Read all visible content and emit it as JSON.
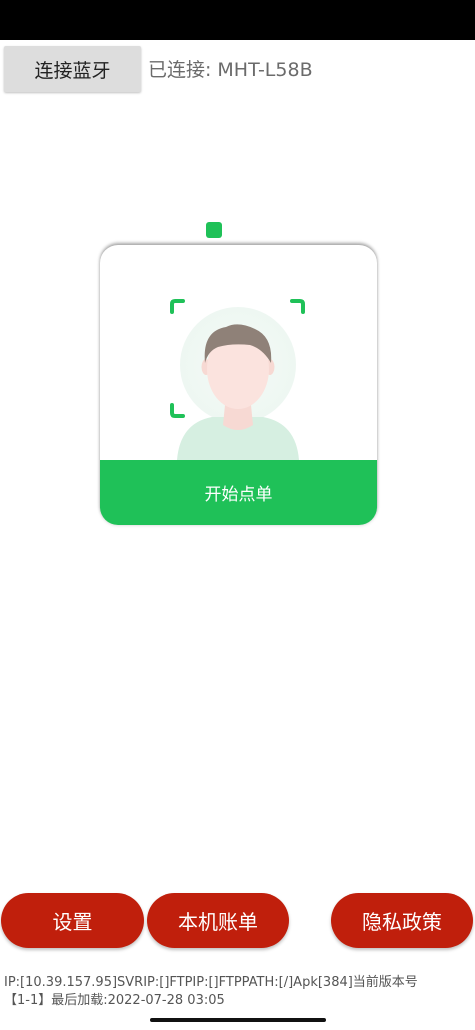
{
  "header": {
    "connect_bluetooth_label": "连接蓝牙",
    "connection_status_label": "已连接:",
    "connected_device": "MHT-L58B"
  },
  "face_card": {
    "start_order_label": "开始点单",
    "accent_color": "#1fc158"
  },
  "footer_buttons": {
    "settings_label": "设置",
    "local_bills_label": "本机账单",
    "privacy_policy_label": "隐私政策",
    "button_color": "#c01f0c"
  },
  "info": {
    "line1": "IP:[10.39.157.95]SVRIP:[]FTPIP:[]FTPPATH:[/]Apk[384]当前版本号",
    "line2": "【1-1】最后加载:2022-07-28 03:05"
  },
  "icons": {
    "face": "person-avatar-icon",
    "camera": "camera-indicator-icon",
    "scan_frame": "scan-frame-icon"
  }
}
